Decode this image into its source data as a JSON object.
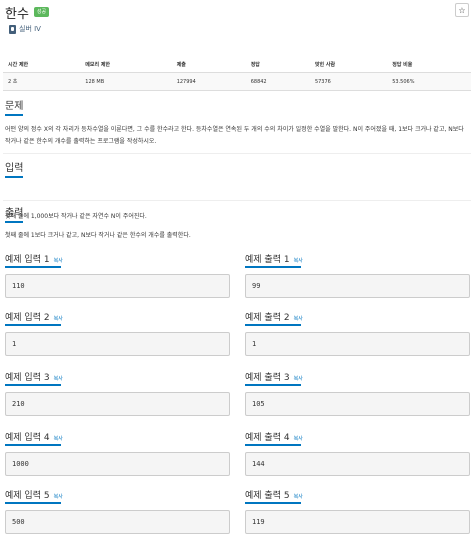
{
  "problem": {
    "title": "한수",
    "badge": "성공",
    "tier": "실버 IV"
  },
  "icons": {
    "star": "star-icon",
    "tier": "silver-tier-icon"
  },
  "colors": {
    "accent": "#0076c0",
    "badge": "#5cb85c",
    "tier": "#435f7a"
  },
  "stats": {
    "headers": [
      "시간 제한",
      "메모리 제한",
      "제출",
      "정답",
      "맞힌 사람",
      "정답 비율"
    ],
    "values": [
      "2 초",
      "128 MB",
      "127994",
      "68842",
      "57376",
      "53.506%"
    ]
  },
  "sections": {
    "problem_heading": "문제",
    "problem_text": "어떤 양의 정수 X의 각 자리가 등차수열을 이룬다면, 그 수를 한수라고 한다. 등차수열은 연속된 두 개의 수의 차이가 일정한 수열을 말한다. N이 주어졌을 때, 1보다 크거나 같고, N보다 작거나 같은 한수의 개수를 출력하는 프로그램을 작성하시오.",
    "input_heading": "입력",
    "input_text": "첫째 줄에 1,000보다 작거나 같은 자연수 N이 주어진다.",
    "output_heading": "출력",
    "output_text": "첫째 줄에 1보다 크거나 같고, N보다 작거나 같은 한수의 개수를 출력한다."
  },
  "copy_label": "복사",
  "examples": [
    {
      "input_label": "예제 입력 1",
      "input": "110",
      "output_label": "예제 출력 1",
      "output": "99"
    },
    {
      "input_label": "예제 입력 2",
      "input": "1",
      "output_label": "예제 출력 2",
      "output": "1"
    },
    {
      "input_label": "예제 입력 3",
      "input": "210",
      "output_label": "예제 출력 3",
      "output": "105"
    },
    {
      "input_label": "예제 입력 4",
      "input": "1000",
      "output_label": "예제 출력 4",
      "output": "144"
    },
    {
      "input_label": "예제 입력 5",
      "input": "500",
      "output_label": "예제 출력 5",
      "output": "119"
    }
  ]
}
